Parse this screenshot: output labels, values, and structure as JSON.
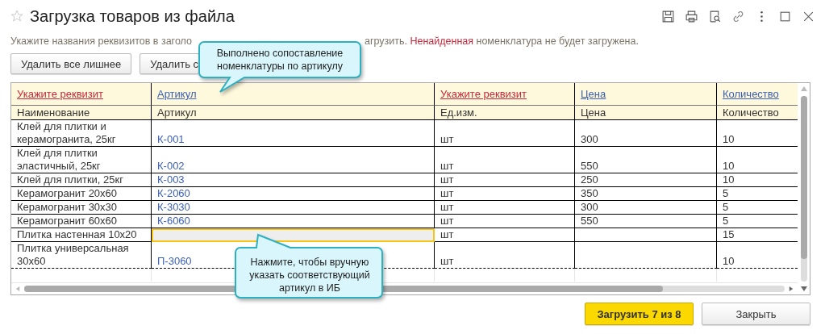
{
  "window": {
    "title": "Загрузка товаров из файла",
    "favorite": false
  },
  "hint": {
    "before": "Укажите названия реквизитов в заголо",
    "after": "агрузить. ",
    "warning": "Ненайденная",
    "rest": " номенклатура не будет загружена."
  },
  "toolbar": [
    "Удалить все лишнее",
    "Удалить с"
  ],
  "columns": [
    {
      "link": "Укажите реквизит",
      "field": "Наименование",
      "kind": "unset"
    },
    {
      "link": "Артикул",
      "field": "Артикул",
      "kind": "set"
    },
    {
      "link": "Укажите реквизит",
      "field": "Ед.изм.",
      "kind": "unset"
    },
    {
      "link": "Цена",
      "field": "Цена",
      "kind": "set"
    },
    {
      "link": "Количество",
      "field": "Количество",
      "kind": "set"
    }
  ],
  "rows": [
    {
      "name": "Клей для плитки и керамогранита, 25кг",
      "article": "К-001",
      "unit": "шт",
      "price": "300",
      "qty": "10",
      "selected": false
    },
    {
      "name": "Клей для плитки эластичный, 25кг",
      "article": "К-002",
      "unit": "шт",
      "price": "550",
      "qty": "10",
      "selected": false
    },
    {
      "name": "Клей для плитки, 25кг",
      "article": "К-003",
      "unit": "шт",
      "price": "250",
      "qty": "10",
      "selected": false
    },
    {
      "name": "Керамогранит 20x60",
      "article": "К-2060",
      "unit": "шт",
      "price": "350",
      "qty": "5",
      "selected": false
    },
    {
      "name": "Керамогранит 30x30",
      "article": "К-3030",
      "unit": "шт",
      "price": "300",
      "qty": "5",
      "selected": false
    },
    {
      "name": "Керамогранит 60x60",
      "article": "К-6060",
      "unit": "шт",
      "price": "550",
      "qty": "5",
      "selected": false
    },
    {
      "name": "Плитка настенная 10x20",
      "unit": "шт",
      "qty": "15",
      "selected": true
    },
    {
      "name": "Плитка универсальная 30x60",
      "article": "П-3060",
      "unit": "шт",
      "qty": "10",
      "selected": false
    }
  ],
  "callouts": [
    {
      "text": "Выполнено сопоставление номенклатуры по артикулу",
      "kind": "down"
    },
    {
      "text": "Нажмите, чтобы вручную указать соответствующий артикул в ИБ",
      "kind": "up"
    }
  ],
  "buttons": [
    {
      "label": "Загрузить 7 из 8",
      "kind": "primary"
    },
    {
      "label": "Закрыть",
      "kind": "normal"
    }
  ]
}
